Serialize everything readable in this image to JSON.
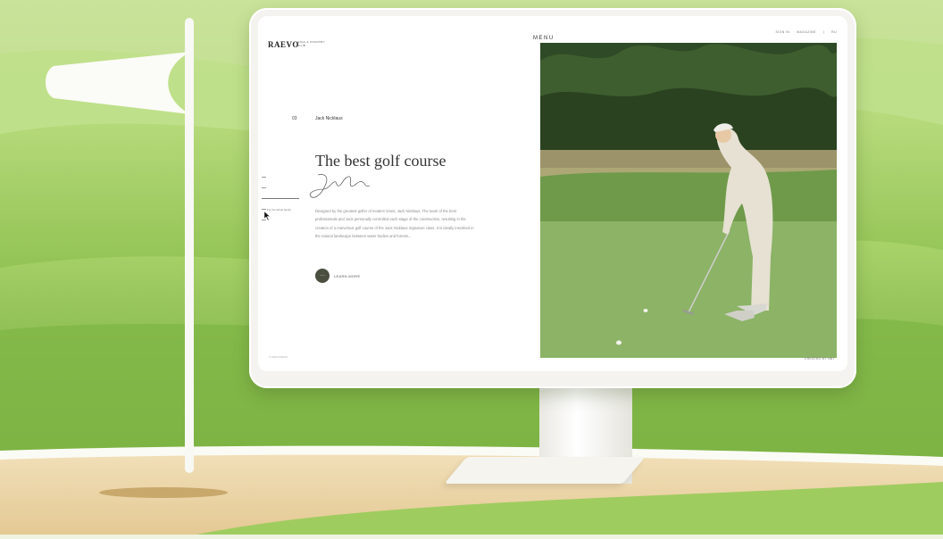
{
  "site": {
    "logo": "RAEVO",
    "logo_sub": "GOLF & COUNTRY CLUB",
    "menu": "MENU",
    "nav": [
      "SIGN IN",
      "MAGAZINE",
      "|",
      "RU"
    ]
  },
  "hero": {
    "number": "03",
    "person": "Jack Nicklaus",
    "headline": "The best golf course",
    "signature": "Jack Nicklaus",
    "description": "Designed by the greatest golfer of modern times, Jack Nicklaus. The team of the best professionals and Jack personally controlled each stage of the construction, resulting in the creation of a marvelous golf course of the Jack Nicklaus Signature class. It is ideally inscribed in the natural landscape between water bodies and forests...",
    "cta_icon": "···",
    "cta_label": "LEARN MORE"
  },
  "sidebar": {
    "label": "For the whole family"
  },
  "footer": {
    "copyright": "© 2020 RAEVO",
    "credits": "CREATED BY NBT"
  },
  "colors": {
    "accent": "#4a4f3f",
    "grass_bg": "#9ccb5a",
    "sand": "#e9d3a6"
  }
}
